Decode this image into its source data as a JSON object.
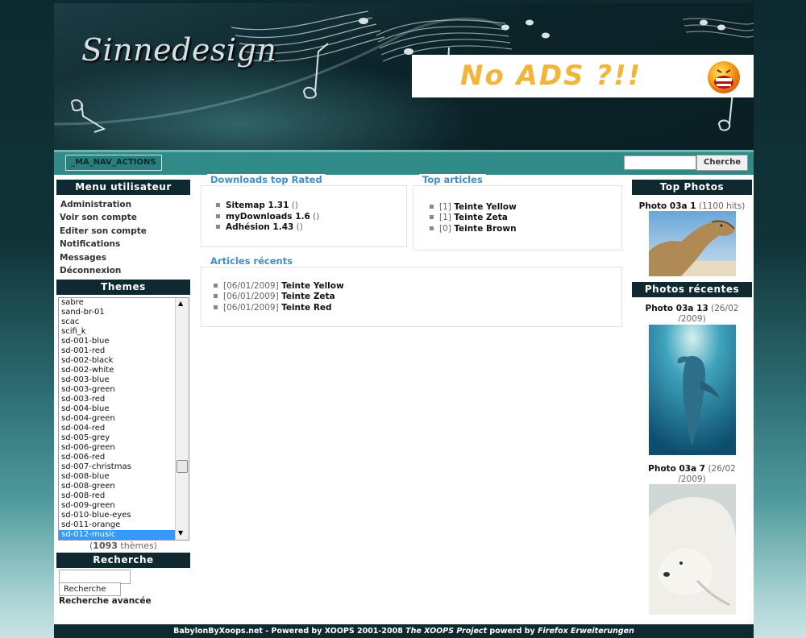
{
  "header": {
    "site_title": "Sinnedesign",
    "banner_text": "No ADS ?!!"
  },
  "navbar": {
    "actions_label": "_MA_NAV_ACTIONS",
    "search_value": "",
    "search_button": "Cherche"
  },
  "user_menu": {
    "title": "Menu utilisateur",
    "items": [
      "Administration",
      "Voir son compte",
      "Editer son compte",
      "Notifications",
      "Messages",
      "Déconnexion"
    ]
  },
  "themes": {
    "title": "Themes",
    "options": [
      "sabre",
      "sand-br-01",
      "scac",
      "scifi_k",
      "sd-001-blue",
      "sd-001-red",
      "sd-002-black",
      "sd-002-white",
      "sd-003-blue",
      "sd-003-green",
      "sd-003-red",
      "sd-004-blue",
      "sd-004-green",
      "sd-004-red",
      "sd-005-grey",
      "sd-006-green",
      "sd-006-red",
      "sd-007-christmas",
      "sd-008-blue",
      "sd-008-green",
      "sd-008-red",
      "sd-009-green",
      "sd-010-blue-eyes",
      "sd-011-orange",
      "sd-012-music"
    ],
    "selected": "sd-012-music",
    "count_open": "(",
    "count": "1093",
    "count_label": " thèmes)"
  },
  "search": {
    "title": "Recherche",
    "input_value": "",
    "button": "Recherche",
    "advanced": "Recherche avancée"
  },
  "downloads": {
    "title": "Downloads top Rated",
    "items": [
      {
        "name": "Sitemap 1.31",
        "extra": " ()"
      },
      {
        "name": "myDownloads 1.6",
        "extra": " ()"
      },
      {
        "name": "Adhésion 1.43",
        "extra": " ()"
      }
    ]
  },
  "top_articles": {
    "title": "Top articles",
    "items": [
      {
        "count": "[1] ",
        "name": "Teinte Yellow"
      },
      {
        "count": "[1] ",
        "name": "Teinte Zeta"
      },
      {
        "count": "[0] ",
        "name": "Teinte Brown"
      }
    ]
  },
  "recent_articles": {
    "title": "Articles récents",
    "items": [
      {
        "date": "[06/01/2009] ",
        "name": "Teinte Yellow"
      },
      {
        "date": "[06/01/2009] ",
        "name": "Teinte Zeta"
      },
      {
        "date": "[06/01/2009] ",
        "name": "Teinte Red"
      }
    ]
  },
  "top_photos": {
    "title": "Top Photos",
    "items": [
      {
        "name": "Photo 03a 1",
        "meta": " (1100 hits)"
      }
    ]
  },
  "recent_photos": {
    "title": "Photos récentes",
    "items": [
      {
        "name": "Photo 03a 13",
        "meta_line1": " (26/02",
        "meta_line2": "/2009)"
      },
      {
        "name": "Photo 03a 7",
        "meta_line1": " (26/02",
        "meta_line2": "/2009)"
      }
    ]
  },
  "footer": {
    "part1": "BabylonByXoops.net - Powered by XOOPS 2001-2008 ",
    "part2": "The XOOPS Project",
    "part3": " powerd by ",
    "part4": "Firefox Erweiterungen"
  },
  "colors": {
    "block_title_bg": "#0e2a30",
    "navbar_bg": "#2f8a88",
    "legend_blue": "#3f8fc7",
    "selected_option": "#3399ff"
  }
}
